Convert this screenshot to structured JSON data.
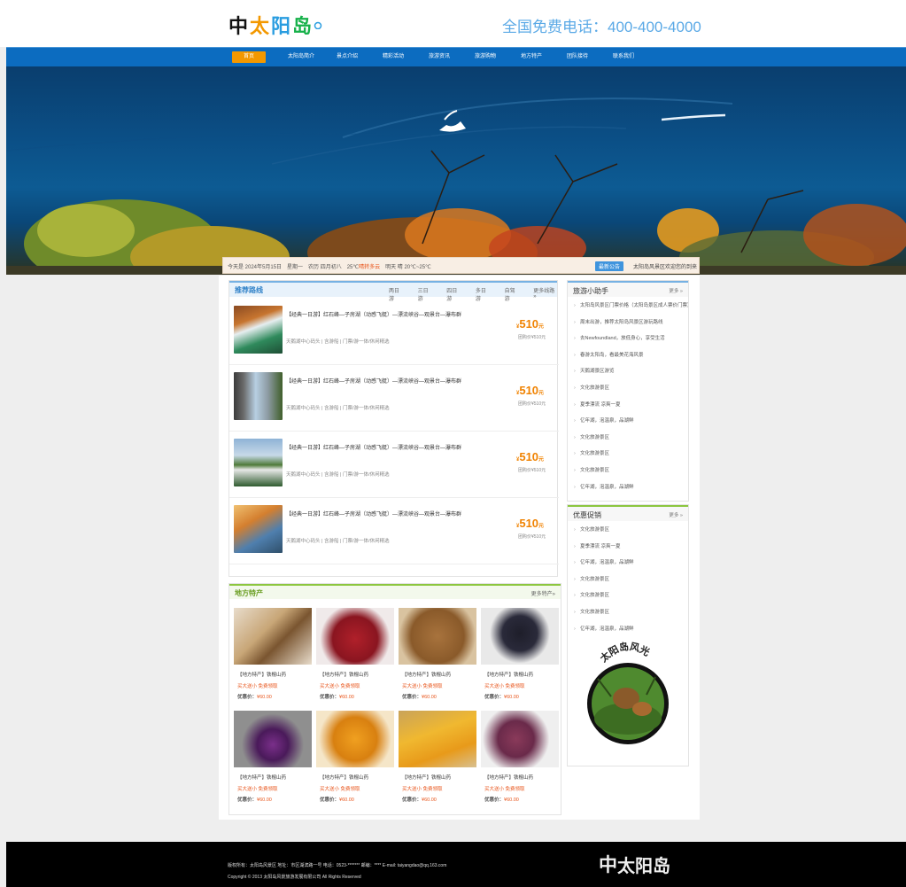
{
  "header": {
    "logo_text": "太阳岛",
    "logo_mark": "中",
    "hotline": "全国免费电话：400-400-4000"
  },
  "nav": {
    "items": [
      {
        "label": "首页"
      },
      {
        "label": "太阳岛简介"
      },
      {
        "label": "景点介绍"
      },
      {
        "label": "精彩活动"
      },
      {
        "label": "旅游资讯"
      },
      {
        "label": "旅游购物"
      },
      {
        "label": "地方特产"
      },
      {
        "label": "团队接待"
      },
      {
        "label": "联系我们"
      }
    ]
  },
  "notice": {
    "weather_prefix": "今天是 2024年5月15日　星期一　农历 四月初八　25℃",
    "weather_highlight": "晴转多云",
    "weather_suffix": "　明天 晴 20℃~25℃",
    "badge": "最新公告",
    "message": "太阳岛风景区欢迎您的到来"
  },
  "routes": {
    "title": "推荐路线",
    "tabs": [
      "两日游",
      "三日游",
      "四日游",
      "多日游",
      "自驾游",
      "更多线路 »"
    ],
    "items": [
      {
        "title": "【经典一日游】红石峰—子房湖（动感飞艇）—漂流峡谷—观景台—瀑布群",
        "sub": "天鹅湖中心码头 | 含游船 | 门票/游一体/休闲精选",
        "price": "510",
        "unit": "元",
        "note": "团购价¥510元"
      },
      {
        "title": "【经典一日游】红石峰—子房湖（动感飞艇）—漂流峡谷—观景台—瀑布群",
        "sub": "天鹅湖中心码头 | 含游船 | 门票/游一体/休闲精选",
        "price": "510",
        "unit": "元",
        "note": "团购价¥510元"
      },
      {
        "title": "【经典一日游】红石峰—子房湖（动感飞艇）—漂流峡谷—观景台—瀑布群",
        "sub": "天鹅湖中心码头 | 含游船 | 门票/游一体/休闲精选",
        "price": "510",
        "unit": "元",
        "note": "团购价¥510元"
      },
      {
        "title": "【经典一日游】红石峰—子房湖（动感飞艇）—漂流峡谷—观景台—瀑布群",
        "sub": "天鹅湖中心码头 | 含游船 | 门票/游一体/休闲精选",
        "price": "510",
        "unit": "元",
        "note": "团购价¥510元"
      }
    ]
  },
  "specialties": {
    "title": "地方特产",
    "more": "更多特产»",
    "items": [
      {
        "name": "【地方特产】铁棍山药",
        "promo": "买大送小 免费领取",
        "price_label": "优惠价：",
        "price": "¥60.00"
      },
      {
        "name": "【地方特产】铁棍山药",
        "promo": "买大送小 免费领取",
        "price_label": "优惠价：",
        "price": "¥60.00"
      },
      {
        "name": "【地方特产】铁棍山药",
        "promo": "买大送小 免费领取",
        "price_label": "优惠价：",
        "price": "¥60.00"
      },
      {
        "name": "【地方特产】铁棍山药",
        "promo": "买大送小 免费领取",
        "price_label": "优惠价：",
        "price": "¥60.00"
      },
      {
        "name": "【地方特产】铁棍山药",
        "promo": "买大送小 免费领取",
        "price_label": "优惠价：",
        "price": "¥60.00"
      },
      {
        "name": "【地方特产】铁棍山药",
        "promo": "买大送小 免费领取",
        "price_label": "优惠价：",
        "price": "¥60.00"
      },
      {
        "name": "【地方特产】铁棍山药",
        "promo": "买大送小 免费领取",
        "price_label": "优惠价：",
        "price": "¥60.00"
      },
      {
        "name": "【地方特产】铁棍山药",
        "promo": "买大送小 免费领取",
        "price_label": "优惠价：",
        "price": "¥60.00"
      }
    ]
  },
  "helper": {
    "title": "旅游小助手",
    "more": "更多 »",
    "items": [
      "太阳岛风景区门票价格（太阳岛景区成人票价门票）",
      "周末出游，推荐太阳岛风景区游玩路线",
      "去Newfoundland，放低身心，享受生活",
      "春游太阳岛，看最美花海风景",
      "天鹅湖景区游览",
      "文化旅游景区",
      "夏季漂流 凉爽一夏",
      "亿年湖，泡温泉，品湖鲜",
      "文化旅游景区",
      "文化旅游景区",
      "文化旅游景区",
      "亿年湖，泡温泉，品湖鲜"
    ]
  },
  "promo": {
    "title": "优惠促销",
    "more": "更多 »",
    "items": [
      "文化旅游景区",
      "夏季漂流 凉爽一夏",
      "亿年湖，泡温泉，品湖鲜",
      "文化旅游景区",
      "文化旅游景区",
      "文化旅游景区",
      "亿年湖，泡温泉，品湖鲜"
    ],
    "seal_text": "太阳岛风光"
  },
  "footer": {
    "line1": "版权所有：太阳岛风景区 地址：市区湖滨路一号 电话：0523-******* 邮编：**** E-mail: taiyangdao@qq.163.com",
    "line2": "Copyright © 2013 太阳岛风景旅游发展有限公司 All Rights Reserved",
    "logo_text": "太阳岛",
    "logo_mark": "中"
  }
}
